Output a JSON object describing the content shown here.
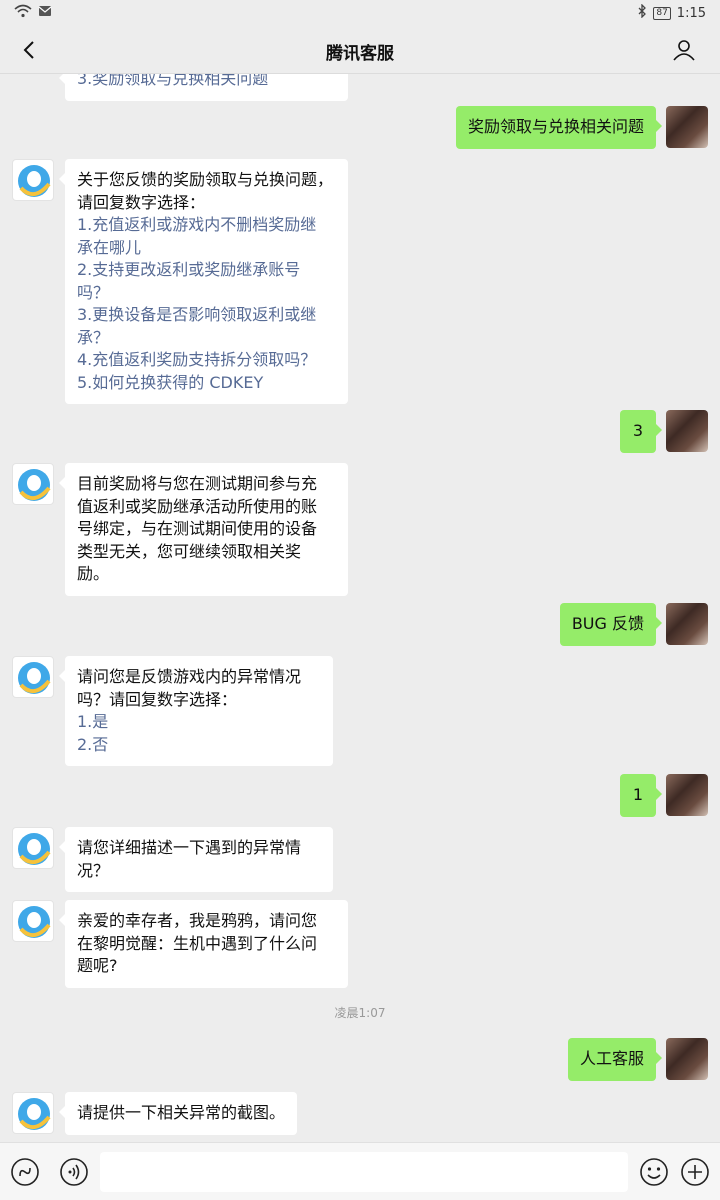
{
  "status": {
    "battery": "87",
    "time": "1:15"
  },
  "header": {
    "title": "腾讯客服"
  },
  "messages": {
    "m0": {
      "lines": [
        "3.奖励领取与兑换相关问题"
      ]
    },
    "m1": {
      "text": "奖励领取与兑换相关问题"
    },
    "m2": {
      "intro": [
        "关于您反馈的奖励领取与兑换问题，",
        "请回复数字选择："
      ],
      "options": [
        "1.充值返利或游戏内不删档奖励继",
        "承在哪儿",
        "2.支持更改返利或奖励继承账号",
        "吗？",
        "3.更换设备是否影响领取返利或继",
        "承？",
        "4.充值返利奖励支持拆分领取吗？",
        "5.如何兑换获得的 CDKEY"
      ]
    },
    "m3": {
      "text": "3"
    },
    "m4": {
      "lines": [
        "目前奖励将与您在测试期间参与充",
        "值返利或奖励继承活动所使用的账",
        "号绑定，与在测试期间使用的设备",
        "类型无关，您可继续领取相关奖",
        "励。"
      ]
    },
    "m5": {
      "text": "BUG 反馈"
    },
    "m6": {
      "intro": [
        "请问您是反馈游戏内的异常情况",
        "吗？请回复数字选择："
      ],
      "options": [
        "1.是",
        "2.否"
      ]
    },
    "m7": {
      "text": "1"
    },
    "m8": {
      "lines": [
        "请您详细描述一下遇到的异常情",
        "况？"
      ]
    },
    "m9": {
      "lines": [
        "亲爱的幸存者，我是鸦鸦，请问您",
        "在黎明觉醒：生机中遇到了什么问",
        "题呢?"
      ]
    },
    "timestamp": "凌晨1:07",
    "m10": {
      "text": "人工客服"
    },
    "m11": {
      "text": "请提供一下相关异常的截图。"
    }
  },
  "icons": {
    "back": "chevron-left-icon",
    "user": "user-icon",
    "mini": "mini-program-icon",
    "voice": "voice-icon",
    "emoji": "emoji-icon",
    "plus": "plus-icon"
  },
  "colors": {
    "background": "#ededed",
    "incoming_bubble": "#ffffff",
    "outgoing_bubble": "#95ec69",
    "option_text": "#576b95",
    "timestamp": "#999999"
  }
}
